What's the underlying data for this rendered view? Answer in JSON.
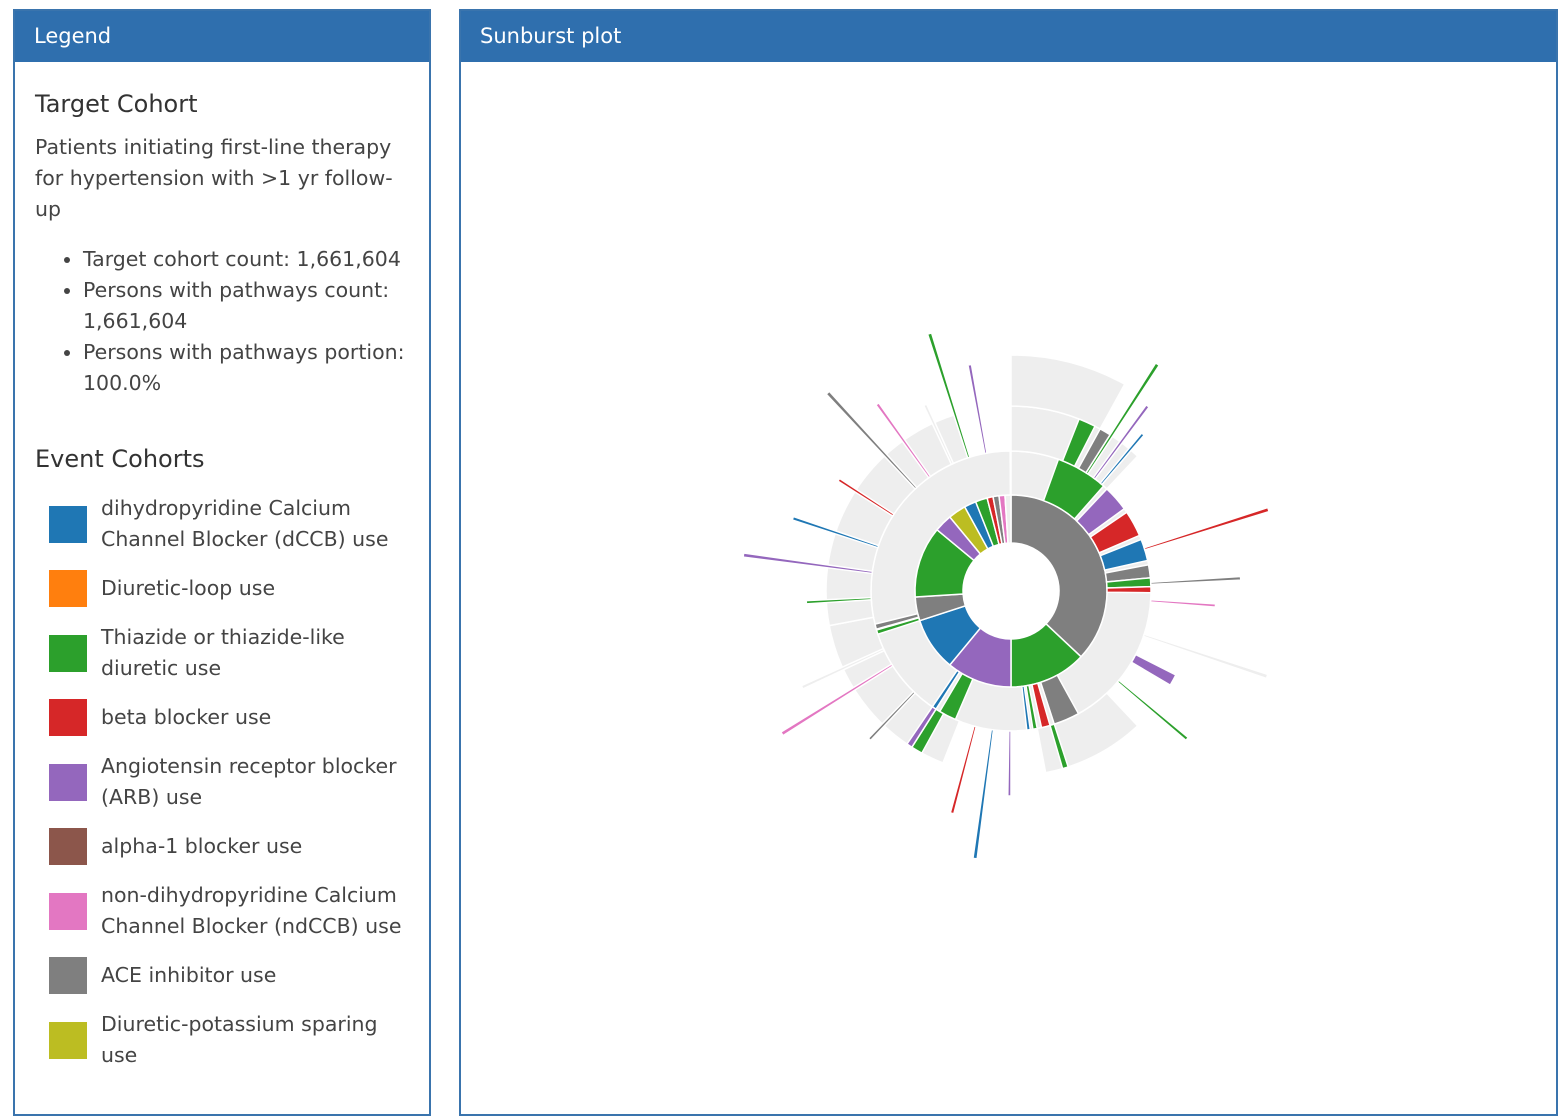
{
  "legend_panel": {
    "header": "Legend",
    "target_title": "Target Cohort",
    "target_description": "Patients initiating first-line therapy for hypertension with >1 yr follow-up",
    "stats": [
      "Target cohort count: 1,661,604",
      "Persons with pathways count: 1,661,604",
      "Persons with pathways portion: 100.0%"
    ],
    "event_title": "Event Cohorts",
    "event_cohorts": [
      {
        "label": "dihydropyridine Calcium Channel Blocker (dCCB) use",
        "color": "#1f77b4"
      },
      {
        "label": "Diuretic-loop use",
        "color": "#ff7f0e"
      },
      {
        "label": "Thiazide or thiazide-like diuretic use",
        "color": "#2ca02c"
      },
      {
        "label": "beta blocker use",
        "color": "#d62728"
      },
      {
        "label": "Angiotensin receptor blocker (ARB) use",
        "color": "#9467bd"
      },
      {
        "label": "alpha-1 blocker use",
        "color": "#8c564b"
      },
      {
        "label": "non-dihydropyridine Calcium Channel Blocker (ndCCB) use",
        "color": "#e377c2"
      },
      {
        "label": "ACE inhibitor use",
        "color": "#7f7f7f"
      },
      {
        "label": "Diuretic-potassium sparing use",
        "color": "#bcbd22"
      }
    ]
  },
  "plot_panel": {
    "header": "Sunburst plot"
  },
  "sunburst": {
    "stop_color": "#eeeeee",
    "inner_ring": [
      {
        "cohort": "ACE inhibitor use",
        "color": "#7f7f7f",
        "portion": 0.37
      },
      {
        "cohort": "Thiazide or thiazide-like diuretic use",
        "color": "#2ca02c",
        "portion": 0.13
      },
      {
        "cohort": "Angiotensin receptor blocker (ARB) use",
        "color": "#9467bd",
        "portion": 0.11
      },
      {
        "cohort": "dihydropyridine Calcium Channel Blocker (dCCB) use",
        "color": "#1f77b4",
        "portion": 0.09
      },
      {
        "cohort": "other",
        "color": "#7f7f7f",
        "portion": 0.04
      },
      {
        "cohort": "Thiazide or thiazide-like diuretic use",
        "color": "#2ca02c",
        "portion": 0.12
      },
      {
        "cohort": "Angiotensin receptor blocker (ARB) use",
        "color": "#9467bd",
        "portion": 0.03
      },
      {
        "cohort": "Diuretic-potassium sparing use",
        "color": "#bcbd22",
        "portion": 0.03
      },
      {
        "cohort": "dihydropyridine Calcium Channel Blocker (dCCB) use",
        "color": "#1f77b4",
        "portion": 0.02
      },
      {
        "cohort": "Thiazide or thiazide-like diuretic use",
        "color": "#2ca02c",
        "portion": 0.02
      },
      {
        "cohort": "beta blocker use",
        "color": "#d62728",
        "portion": 0.01
      },
      {
        "cohort": "ACE inhibitor use",
        "color": "#7f7f7f",
        "portion": 0.01
      },
      {
        "cohort": "non-dihydropyridine Calcium Channel Blocker (ndCCB) use",
        "color": "#e377c2",
        "portion": 0.01
      },
      {
        "cohort": "other",
        "color": "#eeeeee",
        "portion": 0.01
      }
    ],
    "middle_ring": [
      {
        "color": "#2ca02c",
        "start": 0.055,
        "end": 0.115
      },
      {
        "color": "#9467bd",
        "start": 0.12,
        "end": 0.15
      },
      {
        "color": "#d62728",
        "start": 0.155,
        "end": 0.185
      },
      {
        "color": "#1f77b4",
        "start": 0.19,
        "end": 0.215
      },
      {
        "color": "#7f7f7f",
        "start": 0.22,
        "end": 0.235
      },
      {
        "color": "#2ca02c",
        "start": 0.235,
        "end": 0.245
      },
      {
        "color": "#d62728",
        "start": 0.245,
        "end": 0.252
      },
      {
        "color": "#7f7f7f",
        "start": 0.42,
        "end": 0.45
      },
      {
        "color": "#d62728",
        "start": 0.455,
        "end": 0.465
      },
      {
        "color": "#2ca02c",
        "start": 0.47,
        "end": 0.475
      },
      {
        "color": "#1f77b4",
        "start": 0.478,
        "end": 0.482
      },
      {
        "color": "#2ca02c",
        "start": 0.565,
        "end": 0.585
      },
      {
        "color": "#1f77b4",
        "start": 0.59,
        "end": 0.595
      },
      {
        "color": "#2ca02c",
        "start": 0.7,
        "end": 0.705
      },
      {
        "color": "#7f7f7f",
        "start": 0.706,
        "end": 0.712
      }
    ],
    "outer_ring": [
      {
        "color": "#2ca02c",
        "start": 0.06,
        "end": 0.075
      },
      {
        "color": "#7f7f7f",
        "start": 0.08,
        "end": 0.09
      },
      {
        "color": "#9467bd",
        "start": 0.325,
        "end": 0.335
      },
      {
        "color": "#2ca02c",
        "start": 0.45,
        "end": 0.455
      },
      {
        "color": "#2ca02c",
        "start": 0.58,
        "end": 0.59
      },
      {
        "color": "#9467bd",
        "start": 0.59,
        "end": 0.595
      }
    ]
  }
}
